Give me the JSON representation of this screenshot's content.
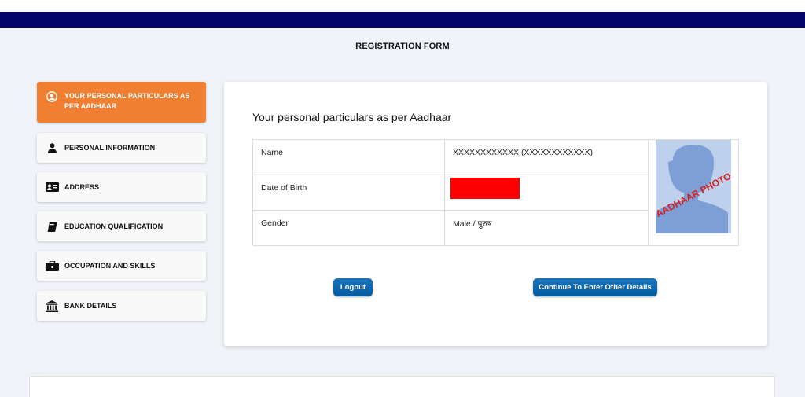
{
  "header": {
    "title": "REGISTRATION FORM"
  },
  "sidebar": {
    "items": [
      {
        "label": "YOUR PERSONAL PARTICULARS AS PER AADHAAR",
        "icon": "user-circle-icon",
        "active": true
      },
      {
        "label": "PERSONAL INFORMATION",
        "icon": "person-icon",
        "active": false
      },
      {
        "label": "ADDRESS",
        "icon": "id-card-icon",
        "active": false
      },
      {
        "label": "EDUCATION QUALIFICATION",
        "icon": "book-icon",
        "active": false
      },
      {
        "label": "OCCUPATION AND SKILLS",
        "icon": "briefcase-icon",
        "active": false
      },
      {
        "label": "BANK DETAILS",
        "icon": "bank-icon",
        "active": false
      }
    ]
  },
  "main": {
    "title": "Your personal particulars as per Aadhaar",
    "rows": [
      {
        "label": "Name",
        "value": "XXXXXXXXXXXX (XXXXXXXXXXXX)"
      },
      {
        "label": "Date of Birth",
        "value": ""
      },
      {
        "label": "Gender",
        "value": "Male / पुरुष"
      }
    ],
    "photo_stamp": "AADHAAR PHOTO",
    "buttons": {
      "logout": "Logout",
      "continue": "Continue To Enter Other Details"
    }
  },
  "colors": {
    "top_bar": "#04046b",
    "active_item": "#f07f31",
    "button": "#035b9e",
    "redaction": "#fe0000"
  }
}
